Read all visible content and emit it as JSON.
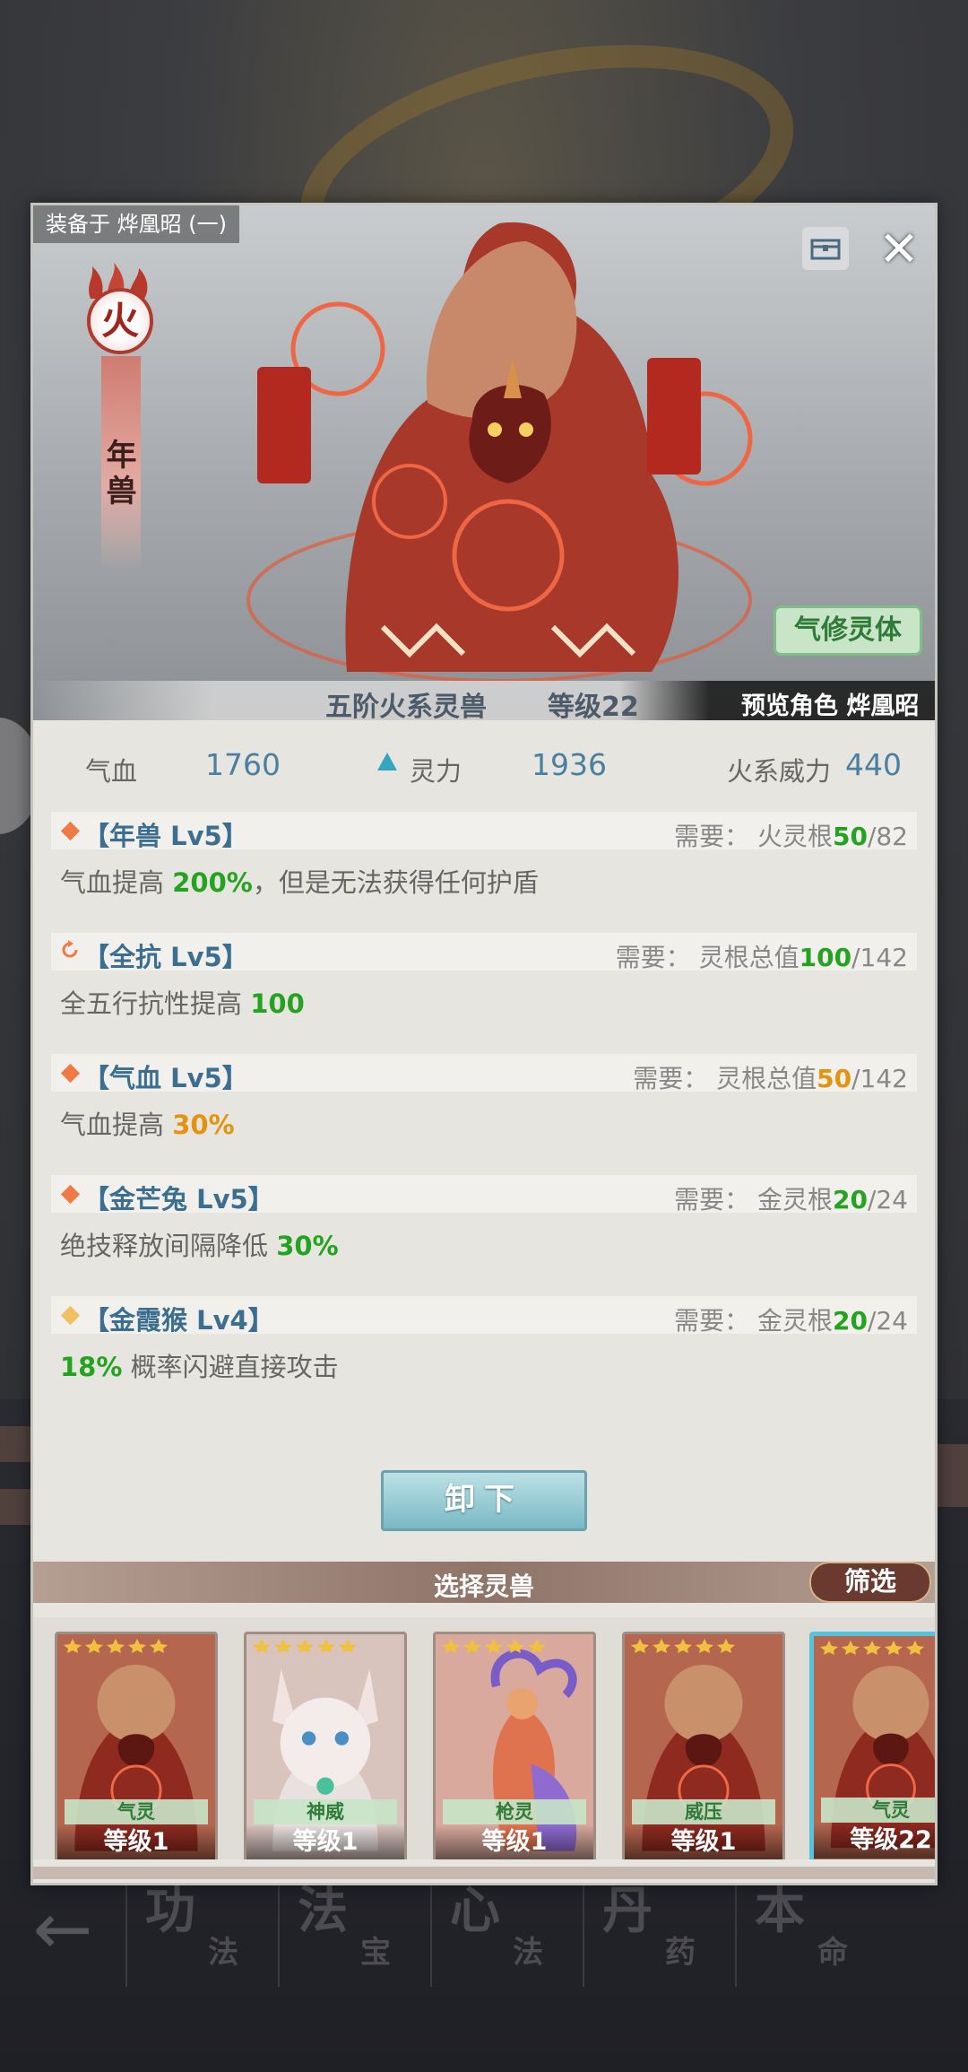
{
  "background": {
    "nav_tabs": [
      {
        "big": "功",
        "small": "法"
      },
      {
        "big": "法",
        "small": "宝"
      },
      {
        "big": "心",
        "small": "法"
      },
      {
        "big": "丹",
        "small": "药"
      },
      {
        "big": "本",
        "small": "命"
      }
    ]
  },
  "header": {
    "equipped_on": "装备于 烨凰昭 (一)"
  },
  "beast": {
    "element": "火",
    "name": "年兽",
    "body_type_tag": "气修灵体",
    "rank": "五阶火系灵兽",
    "level": "等级22",
    "preview": "预览角色 烨凰昭"
  },
  "stats": {
    "hp_label": "气血",
    "hp_value": "1760",
    "spirit_label": "灵力",
    "spirit_value": "1936",
    "fire_label": "火系威力",
    "fire_value": "440"
  },
  "skills": [
    {
      "name": "【年兽 Lv5】",
      "req_prefix": "需要：  火灵根",
      "req_current": "50",
      "req_total": "/82",
      "desc_before": "气血提高 ",
      "desc_value": "200%",
      "desc_after": "，但是无法获得任何护盾"
    },
    {
      "name": "【全抗 Lv5】",
      "req_prefix": "需要：  灵根总值",
      "req_current": "100",
      "req_total": "/142",
      "desc_before": "全五行抗性提高 ",
      "desc_value": "100",
      "desc_after": ""
    },
    {
      "name": "【气血 Lv5】",
      "req_prefix": "需要：  灵根总值",
      "req_current": "50",
      "req_total": "/142",
      "desc_before": "气血提高 ",
      "desc_value": "30%",
      "desc_after": ""
    },
    {
      "name": "【金芒兔 Lv5】",
      "req_prefix": "需要：  金灵根",
      "req_current": "20",
      "req_total": "/24",
      "desc_before": "绝技释放间隔降低 ",
      "desc_value": "30%",
      "desc_after": ""
    },
    {
      "name": "【金霞猴 Lv4】",
      "req_prefix": "需要：  金灵根",
      "req_current": "20",
      "req_total": "/24",
      "desc_before": "",
      "desc_value": "18%",
      "desc_after": " 概率闪避直接攻击"
    }
  ],
  "actions": {
    "unequip_label": "卸下"
  },
  "selector": {
    "title": "选择灵兽",
    "filter_label": "筛选",
    "cards": [
      {
        "type": "气灵",
        "level": "等级1",
        "art": "nian-beast",
        "selected": false
      },
      {
        "type": "神威",
        "level": "等级1",
        "art": "white-cat",
        "selected": false
      },
      {
        "type": "枪灵",
        "level": "等级1",
        "art": "phoenix",
        "selected": false
      },
      {
        "type": "威压",
        "level": "等级1",
        "art": "nian-beast",
        "selected": false
      },
      {
        "type": "气灵",
        "level": "等级22",
        "art": "nian-beast",
        "selected": true
      }
    ]
  },
  "colors": {
    "accent_blue": "#3c6e90",
    "value_green": "#23a31f",
    "value_orange": "#e3930d",
    "fire_red": "#b13a2e",
    "selected_border": "#55c2de"
  }
}
